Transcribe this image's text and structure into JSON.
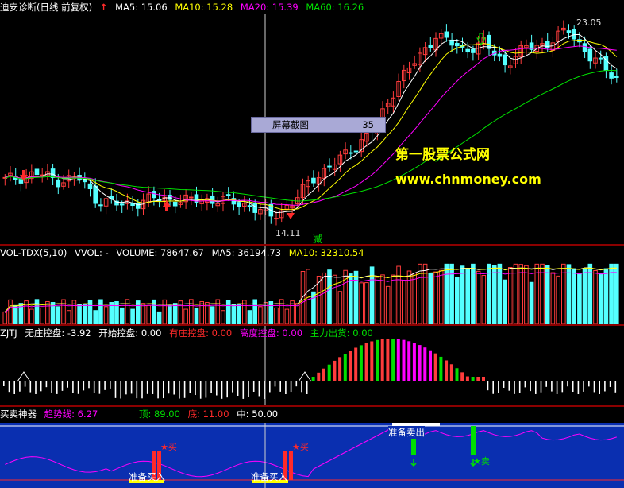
{
  "price_panel": {
    "title": "迪安诊断(日线 前复权)",
    "ma5": "MA5: 15.06",
    "ma10": "MA10: 15.28",
    "ma20": "MA20: 15.39",
    "ma60": "MA60: 16.26",
    "high_label": "23.05",
    "low_label": "14.11",
    "reduce_label": "减",
    "screenshot_tip": "屏幕截图",
    "screenshot_tip_num": "35",
    "watermark_cn": "第一股票公式网",
    "watermark_url": "www.chnmoney.com"
  },
  "volume_panel": {
    "title": "VOL-TDX(5,10)",
    "vvol": "VVOL: -",
    "volume": "VOLUME: 78647.67",
    "ma5": "MA5: 36194.73",
    "ma10": "MA10: 32310.54"
  },
  "zjtj_panel": {
    "title": "ZJTJ",
    "wzkp": "无庄控盘: -3.92",
    "ksk": "开始控盘: 0.00",
    "yzk": "有庄控盘: 0.00",
    "gdk": "高度控盘: 0.00",
    "zlch": "主力出货: 0.00"
  },
  "bs_panel": {
    "title": "买卖神器",
    "trend": "趋势线: 6.27",
    "top": "顶: 89.00",
    "bottom": "底: 11.00",
    "mid": "中: 50.00",
    "prep_buy_1": "准备买入",
    "prep_buy_2": "准备买入",
    "prep_sell": "准备卖出",
    "buy_1": "买",
    "buy_2": "买",
    "sell": "卖"
  },
  "colors": {
    "up": "#ff3c3c",
    "down": "#54ffff",
    "ma5": "#ffffff",
    "ma10": "#ffff00",
    "ma20": "#ff00ff",
    "ma60": "#00e000",
    "bs_bg": "#0a2fb0"
  },
  "icons": [
    "up-arrow-icon",
    "down-arrow-icon",
    "crosshair"
  ]
}
